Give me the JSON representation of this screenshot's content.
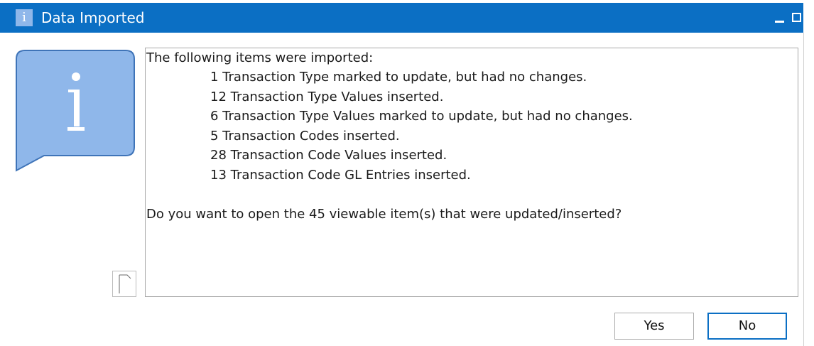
{
  "dialog": {
    "title": "Data Imported",
    "title_icon_glyph": "i",
    "colors": {
      "titlebar": "#0b6fc4",
      "icon_fill": "#8fb7ea",
      "icon_stroke": "#3f74b8"
    }
  },
  "message": {
    "intro": "The following items were imported:",
    "items": [
      "1 Transaction Type marked to update, but had no changes.",
      "12 Transaction Type Values inserted.",
      "6 Transaction Type Values marked to update, but had no changes.",
      "5 Transaction Codes inserted.",
      "28 Transaction Code Values inserted.",
      "13 Transaction Code GL Entries inserted."
    ],
    "question": "Do you want to open the 45 viewable item(s) that were updated/inserted?"
  },
  "icons": {
    "window": "info-icon",
    "big": "info-speech-bubble-icon",
    "copy": "copy-document-icon",
    "minimize": "minimize-icon",
    "maximize": "maximize-icon"
  },
  "buttons": {
    "yes": "Yes",
    "no": "No"
  }
}
